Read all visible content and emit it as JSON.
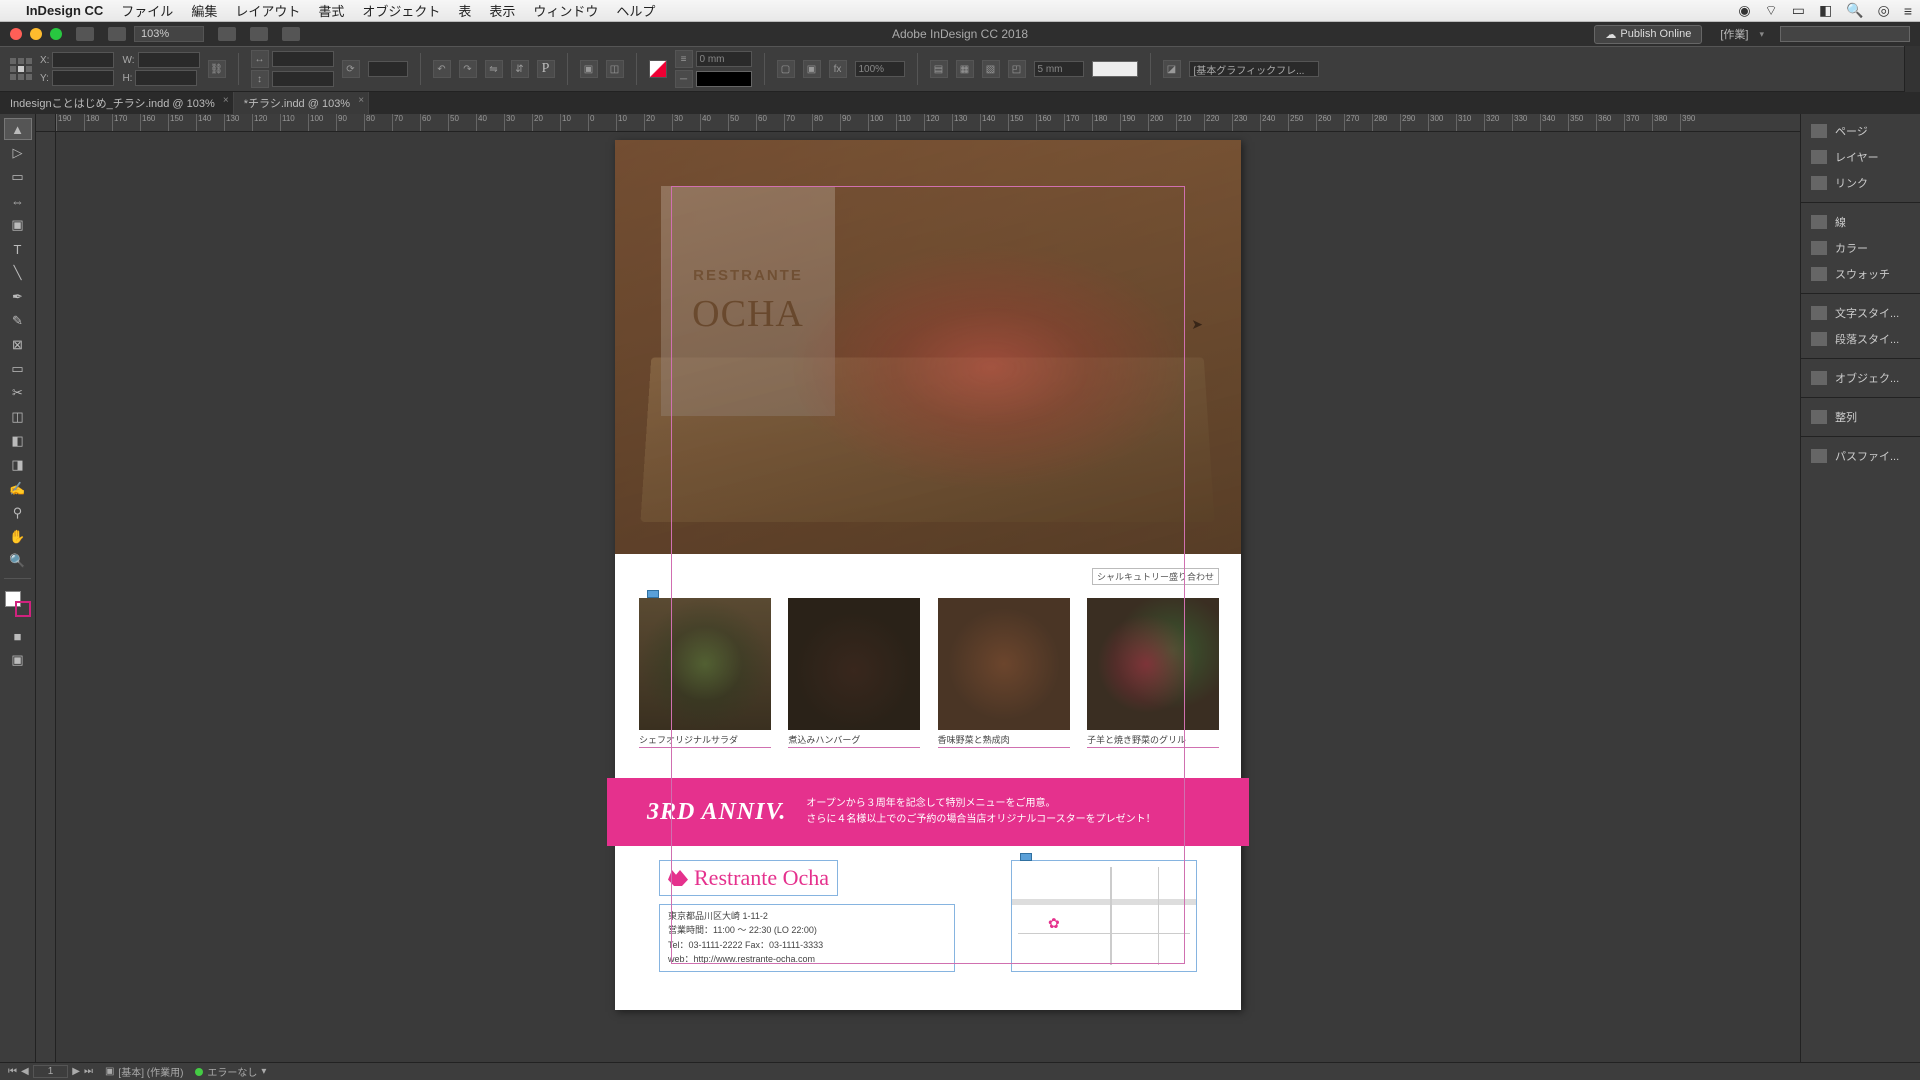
{
  "menubar": {
    "app": "InDesign CC",
    "items": [
      "ファイル",
      "編集",
      "レイアウト",
      "書式",
      "オブジェクト",
      "表",
      "表示",
      "ウィンドウ",
      "ヘルプ"
    ]
  },
  "titlebar": {
    "zoom": "103%",
    "title": "Adobe InDesign CC 2018",
    "publish": "Publish Online",
    "workspace": "[作業]"
  },
  "controlbar": {
    "x_label": "X:",
    "x_val": "",
    "y_label": "Y:",
    "y_val": "",
    "w_label": "W:",
    "w_val": "",
    "h_label": "H:",
    "h_val": "",
    "stroke_val": "0 mm",
    "scale_val": "100%",
    "gap_val": "5 mm",
    "style_select": "[基本グラフィックフレ..."
  },
  "doc_tabs": [
    "Indesignことはじめ_チラシ.indd @ 103%",
    "*チラシ.indd @ 103%"
  ],
  "ruler_ticks": [
    "190",
    "180",
    "170",
    "160",
    "150",
    "140",
    "130",
    "120",
    "110",
    "100",
    "90",
    "80",
    "70",
    "60",
    "50",
    "40",
    "30",
    "20",
    "10",
    "0",
    "10",
    "20",
    "30",
    "40",
    "50",
    "60",
    "70",
    "80",
    "90",
    "100",
    "110",
    "120",
    "130",
    "140",
    "150",
    "160",
    "170",
    "180",
    "190",
    "200",
    "210",
    "220",
    "230",
    "240",
    "250",
    "260",
    "270",
    "280",
    "290",
    "300",
    "310",
    "320",
    "330",
    "340",
    "350",
    "360",
    "370",
    "380",
    "390"
  ],
  "flyer": {
    "hero_line1": "RESTRANTE",
    "hero_line2": "OCHA",
    "hero_caption": "シャルキュトリー盛り合わせ",
    "thumbs": [
      {
        "cap": "シェフオリジナルサラダ"
      },
      {
        "cap": "煮込みハンバーグ"
      },
      {
        "cap": "香味野菜と熟成肉"
      },
      {
        "cap": "子羊と焼き野菜のグリル"
      }
    ],
    "anniv_big": "3RD ANNIV.",
    "anniv_l1": "オープンから３周年を記念して特別メニューをご用意。",
    "anniv_l2": "さらに４名様以上でのご予約の場合当店オリジナルコースターをプレゼント！",
    "logo_text": "Restrante Ocha",
    "info_lines": [
      "東京都品川区大崎 1-11-2",
      "営業時間：11:00 〜 22:30 (LO 22:00)",
      "Tel：03-1111-2222 Fax：03-1111-3333",
      "web：http://www.restrante-ocha.com"
    ]
  },
  "panels": [
    "ページ",
    "レイヤー",
    "リンク",
    "|",
    "線",
    "カラー",
    "スウォッチ",
    "|",
    "文字スタイ...",
    "段落スタイ...",
    "|",
    "オブジェク...",
    "|",
    "整列",
    "|",
    "パスファイ..."
  ],
  "statusbar": {
    "page": "1",
    "profile": "[基本] (作業用)",
    "errors": "エラーなし"
  }
}
